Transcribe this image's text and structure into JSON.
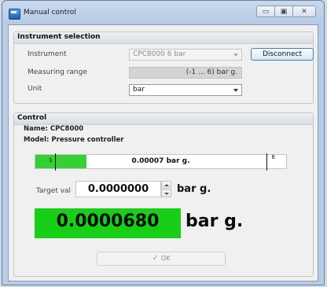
{
  "window": {
    "title": "Manual control",
    "controls": {
      "minimize": "▭",
      "maximize": "▣",
      "close": "✕"
    }
  },
  "instrument_selection": {
    "heading": "Instrument selection",
    "instrument_label": "Instrument",
    "instrument_value": "CPC8000 6 bar",
    "disconnect_label": "Disconnect",
    "range_label": "Measuring range",
    "range_value": "(-1 ... 6) bar g.",
    "unit_label": "Unit",
    "unit_value": "bar"
  },
  "control": {
    "heading": "Control",
    "name_line": "Name: CPC8000",
    "model_line": "Model: Pressure controller",
    "bar": {
      "min_label": "-1",
      "max_label": "6",
      "value_text": "0.00007 bar g.",
      "fill_fraction": 0.2
    },
    "target_label": "Target val",
    "target_value": "0.0000000",
    "target_unit": "bar g.",
    "big_value": "0.0000680",
    "big_unit": "bar g.",
    "ok_label": "OK"
  },
  "colors": {
    "accent_green": "#18cf18",
    "bar_green": "#34d034"
  }
}
